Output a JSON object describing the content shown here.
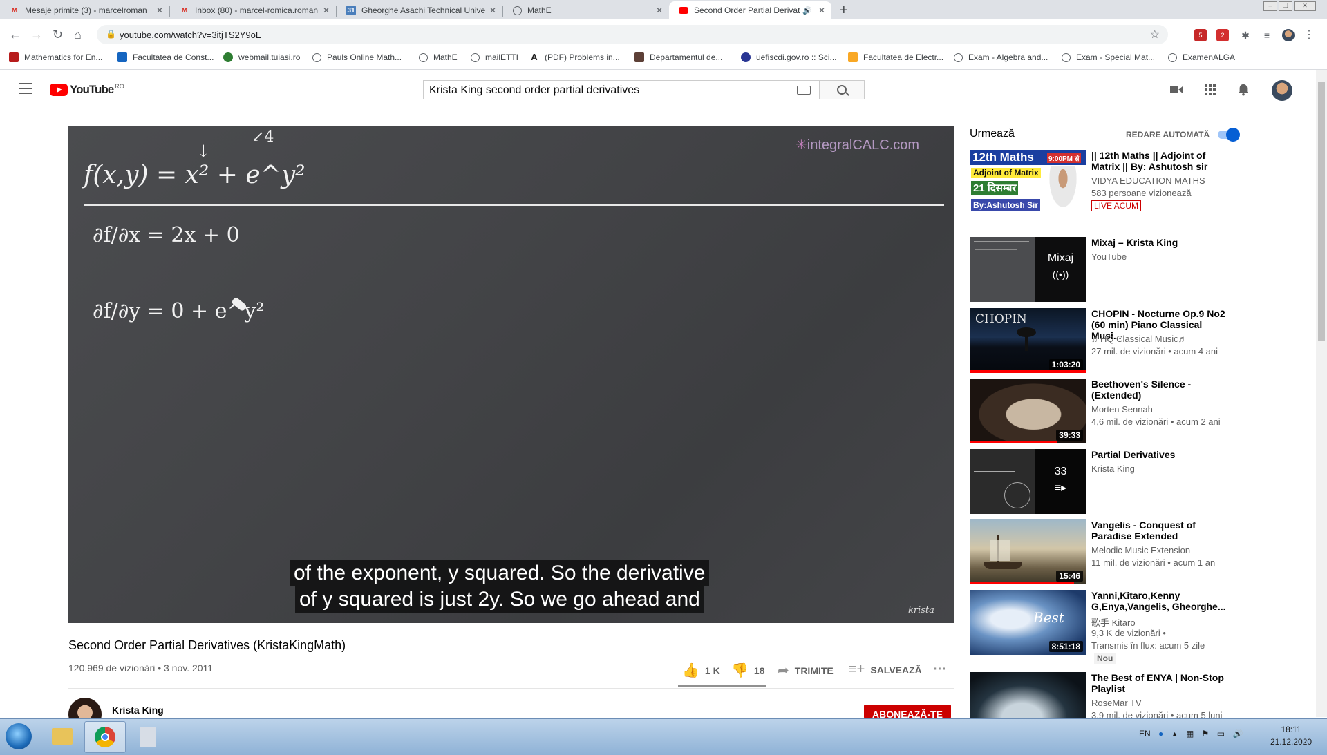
{
  "browser": {
    "tabs": [
      {
        "title": "Mesaje primite (3) - marcelroman",
        "favicon": "gmail-icon"
      },
      {
        "title": "Inbox (80) - marcel-romica.roman",
        "favicon": "gmail-icon"
      },
      {
        "title": "Gheorghe Asachi Technical Unive",
        "favicon": "calendar-icon"
      },
      {
        "title": "MathE",
        "favicon": "globe-icon"
      },
      {
        "title": "Second Order Partial Derivat",
        "favicon": "youtube-icon",
        "active": true
      }
    ],
    "url": "youtube.com/watch?v=3itjTS2Y9oE",
    "bookmarks": [
      "Mathematics for En...",
      "Facultatea de Const...",
      "webmail.tuiasi.ro",
      "Pauls Online Math...",
      "MathE",
      "mailETTI",
      "(PDF) Problems in...",
      "Departamentul de...",
      "uefiscdi.gov.ro :: Sci...",
      "Facultatea de Electr...",
      "Exam - Algebra and...",
      "Exam - Special Mat...",
      "ExamenALGA"
    ],
    "extension_badges": [
      "5",
      "2"
    ]
  },
  "youtube": {
    "region": "RO",
    "logo_text": "YouTube",
    "search_value": "Krista King second order partial derivatives"
  },
  "video": {
    "watermark": "integralCALC.com",
    "signature": "krista",
    "chalk": {
      "function": "f(x,y) = x² + e^y²",
      "dfdx": "∂f/∂x = 2x + 0",
      "dfdy": "∂f/∂y = 0 + e^y²",
      "marks": [
        "↓",
        "↙4"
      ]
    },
    "caption_lines": [
      "of the exponent, y squared. So the derivative",
      "of y squared is just 2y. So we go ahead and"
    ],
    "title": "Second Order Partial Derivatives (KristaKingMath)",
    "views": "120.969 de vizionări",
    "date": "3 nov. 2011",
    "likes": "1 K",
    "dislikes": "18",
    "share_label": "TRIMITE",
    "save_label": "SALVEAZĂ",
    "channel": "Krista King",
    "subscribe_label": "ABONEAZĂ-TE"
  },
  "sidebar": {
    "next_label": "Urmează",
    "autoplay_label": "REDARE AUTOMATĂ",
    "autoplay_on": true,
    "items": [
      {
        "title": "|| 12th Maths || Adjoint of Matrix || By: Ashutosh sir",
        "channel": "VIDYA EDUCATION MATHS",
        "meta": "583 persoane vizionează",
        "badge": "LIVE ACUM",
        "thumb_text": [
          "12th Maths",
          "9:00PM से",
          "Adjoint of Matrix",
          "21 दिसम्बर",
          "By:Ashutosh Sir"
        ]
      },
      {
        "title": "Mixaj – Krista King",
        "channel": "YouTube",
        "overlay": "Mixaj"
      },
      {
        "title": "CHOPIN - Nocturne Op.9 No2 (60 min) Piano Classical Musi...",
        "channel": "♬HQ Classical Music♬",
        "meta": "27 mil. de vizionări • acum 4 ani",
        "duration": "1:03:20",
        "thumb_text": [
          "CHOPIN"
        ],
        "progress": 1.0
      },
      {
        "title": "Beethoven's Silence - (Extended)",
        "channel": "Morten Sennah",
        "meta": "4,6 mil. de vizionări • acum 2 ani",
        "duration": "39:33",
        "progress": 0.75
      },
      {
        "title": "Partial Derivatives",
        "channel": "Krista King",
        "overlay": "33"
      },
      {
        "title": "Vangelis - Conquest of Paradise Extended",
        "channel": "Melodic Music Extension",
        "meta": "11 mil. de vizionări • acum 1 an",
        "duration": "15:46",
        "progress": 0.9
      },
      {
        "title": "Yanni,Kitaro,Kenny G,Enya,Vangelis, Gheorghe...",
        "channel": "歌手 Kitaro",
        "meta": "9,3 K de vizionări •",
        "meta2": "Transmis în flux: acum 5 zile",
        "badge": "Nou",
        "duration": "8:51:18"
      },
      {
        "title": "The Best of ENYA | Non-Stop Playlist",
        "channel": "RoseMar TV",
        "meta": "3,9 mil. de vizionări • acum 5 luni"
      }
    ]
  },
  "taskbar": {
    "lang": "EN",
    "time": "18:11",
    "date": "21.12.2020"
  }
}
